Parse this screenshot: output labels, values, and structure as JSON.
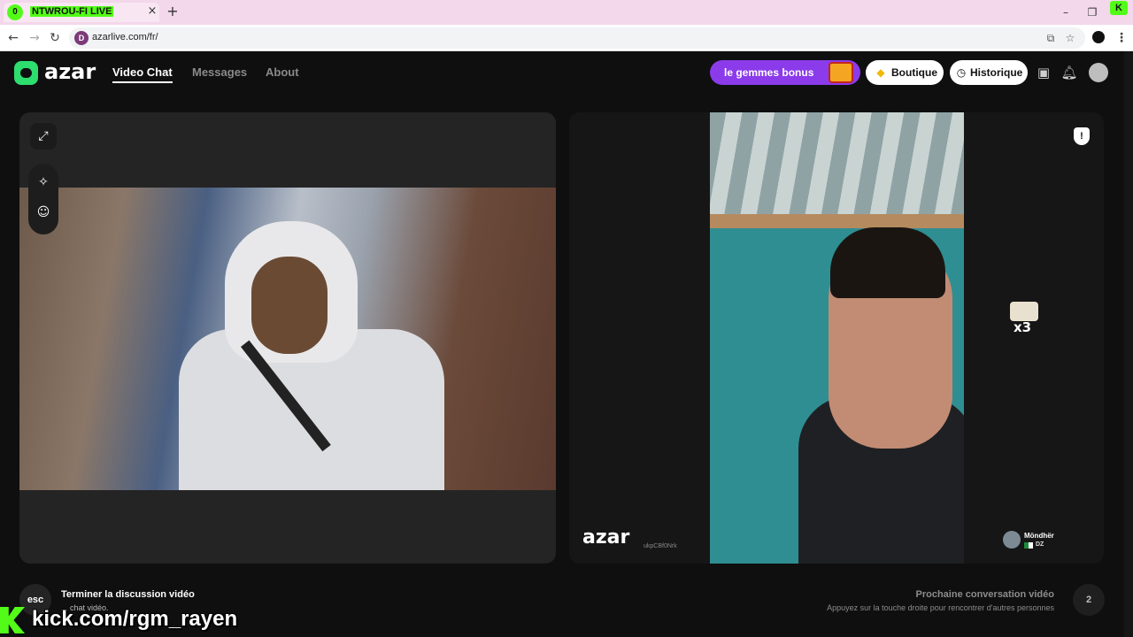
{
  "browser": {
    "tab": {
      "live_count": "0",
      "title": "NTWROU-FI LIVE",
      "close_glyph": "×"
    },
    "new_tab_glyph": "+",
    "window_controls": {
      "minimize": "–",
      "restore": "❐",
      "close": "✕"
    },
    "extension_badge": "K",
    "nav": {
      "back": "←",
      "forward": "→",
      "reload": "↻"
    },
    "url": "azarlive.com/fr/",
    "site_icon_glyph": "D",
    "menu_glyph": "⋮"
  },
  "header": {
    "logo_text": "azar",
    "nav": [
      {
        "label": "Video Chat",
        "active": true
      },
      {
        "label": "Messages",
        "active": false
      },
      {
        "label": "About",
        "active": false
      }
    ],
    "gems_button": "le gemmes bonus",
    "boutique_button": "Boutique",
    "historique_button": "Historique",
    "icons": [
      "inbox-icon",
      "bell-icon",
      "user-avatar"
    ]
  },
  "self_panel": {
    "tools": [
      "expand-icon",
      "magic-wand-icon",
      "face-filter-icon"
    ]
  },
  "remote_panel": {
    "watermark": "azar",
    "watermark_id": "ukpCBf0Nrk",
    "gift_multiplier": "x3",
    "user": {
      "name": "Möndhër",
      "country": "DZ"
    }
  },
  "bottom": {
    "esc_key": "esc",
    "end_title": "Terminer la discussion vidéo",
    "end_hint": "... chat vidéo.",
    "next_title": "Prochaine conversation vidéo",
    "next_hint": "Appuyez sur la touche droite pour rencontrer d'autres personnes",
    "next_key": "2"
  },
  "overlay": {
    "kick_handle": "kick.com/rgm_rayen"
  },
  "colors": {
    "accent_green": "#53fc18",
    "gems_purple": "#8b3bea",
    "brand_green": "#2dde6e"
  }
}
